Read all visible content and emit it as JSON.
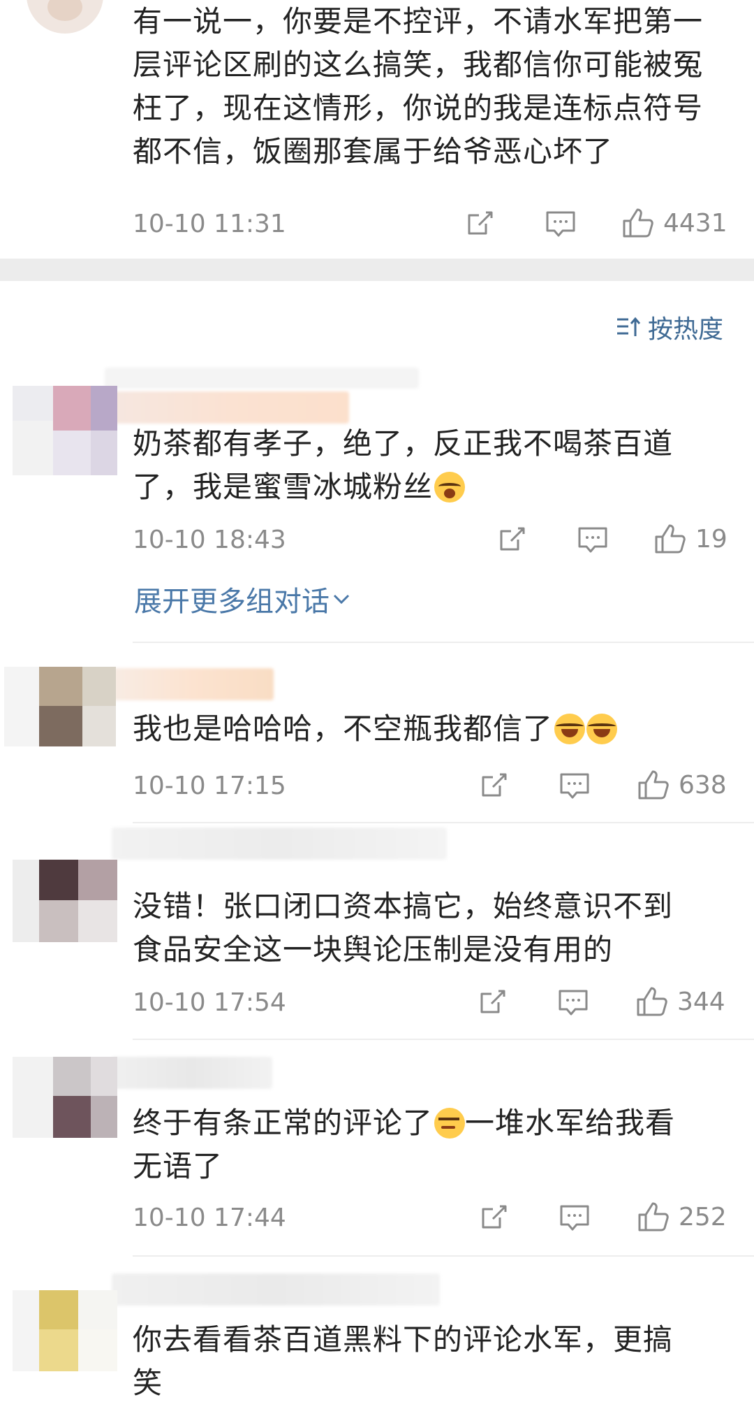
{
  "top_comment": {
    "text_lines": [
      "有一说一，你要是不控评，不请水军把第一",
      "层评论区刷的这么搞笑，我都信你可能被冤",
      "枉了，现在这情形，你说的我是连标点符号",
      "都不信，饭圈那套属于给爷恶心坏了"
    ],
    "time": "10-10 11:31",
    "likes": "4431"
  },
  "sort": {
    "label": "按热度"
  },
  "comments": [
    {
      "text_lines": [
        "奶茶都有孝子，绝了，反正我不喝茶百道",
        "了，我是蜜雪冰城粉丝"
      ],
      "time": "10-10 18:43",
      "likes": "19",
      "expand": "展开更多组对话"
    },
    {
      "text_lines": [
        "我也是哈哈哈，不空瓶我都信了"
      ],
      "time": "10-10 17:15",
      "likes": "638"
    },
    {
      "text_lines": [
        "没错！张口闭口资本搞它，始终意识不到",
        "食品安全这一块舆论压制是没有用的"
      ],
      "time": "10-10 17:54",
      "likes": "344"
    },
    {
      "text_lines": [
        "终于有条正常的评论了",
        "一堆水军给我看",
        "无语了"
      ],
      "time": "10-10 17:44",
      "likes": "252"
    },
    {
      "text_lines": [
        "你去看看茶百道黑料下的评论水军，更搞",
        "笑"
      ]
    }
  ],
  "icons": {
    "share": "share-icon",
    "comment": "comment-icon",
    "like": "like-icon",
    "sort": "sort-icon",
    "chevron": "chevron-down-icon"
  },
  "colors": {
    "link": "#4a78a8",
    "meta": "#8a8a8a",
    "band": "#ececec"
  }
}
